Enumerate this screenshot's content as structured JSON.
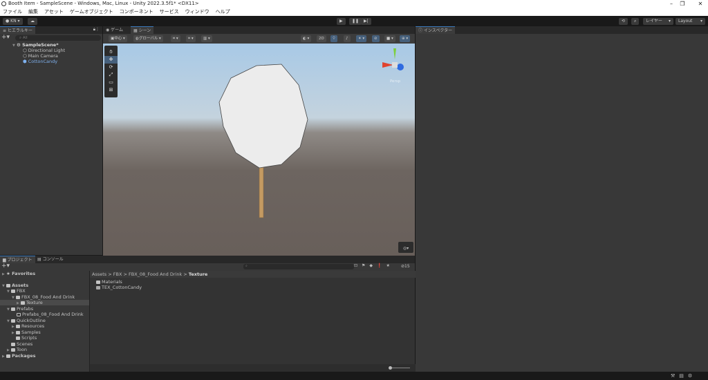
{
  "window": {
    "title": "Booth Item - SampleScene - Windows, Mac, Linux - Unity 2022.3.5f1* <DX11>",
    "controls": [
      "–",
      "❐",
      "✕"
    ]
  },
  "menu": [
    "ファイル",
    "編集",
    "アセット",
    "ゲームオブジェクト",
    "コンポーネント",
    "サービス",
    "ウィンドウ",
    "ヘルプ"
  ],
  "toolbar": {
    "account": "KN",
    "layers": "レイヤー",
    "layout": "Layout",
    "play": "▶",
    "pause": "❚❚",
    "step": "▶|"
  },
  "hierarchy": {
    "tab": "ヒエラルキー",
    "search_placeholder": "All",
    "scene": "SampleScene*",
    "items": [
      "Directional Light",
      "Main Camera",
      "CottonCandy"
    ]
  },
  "scene_view": {
    "tabs": [
      "ゲーム",
      "シーン"
    ],
    "pivot": "中心",
    "space": "グローバル",
    "mode_2d": "2D",
    "gizmo_label": "Persp"
  },
  "inspector": {
    "tab": "インスペクター"
  },
  "project": {
    "tabs": [
      "プロジェクト",
      "コンソール"
    ],
    "hidden_count": "15",
    "favorites": "Favorites",
    "tree": [
      {
        "label": "Assets",
        "bold": true
      },
      {
        "label": "FBX"
      },
      {
        "label": "FBX_08_Food And Drink"
      },
      {
        "label": "Texture"
      },
      {
        "label": "Prefabs"
      },
      {
        "label": "Prefabs_08_Food And Drink"
      },
      {
        "label": "QuickOutline"
      },
      {
        "label": "Resources"
      },
      {
        "label": "Samples"
      },
      {
        "label": "Scripts"
      },
      {
        "label": "Scenes"
      },
      {
        "label": "Toon"
      },
      {
        "label": "Packages",
        "bold": true
      }
    ],
    "breadcrumb": [
      "Assets",
      "FBX",
      "FBX_08_Food And Drink",
      "Texture"
    ],
    "files": [
      "Materials",
      "TEX_CottonCandy"
    ]
  },
  "colors": {
    "accent": "#3a79bb",
    "selected_text": "#7fb2f0"
  }
}
